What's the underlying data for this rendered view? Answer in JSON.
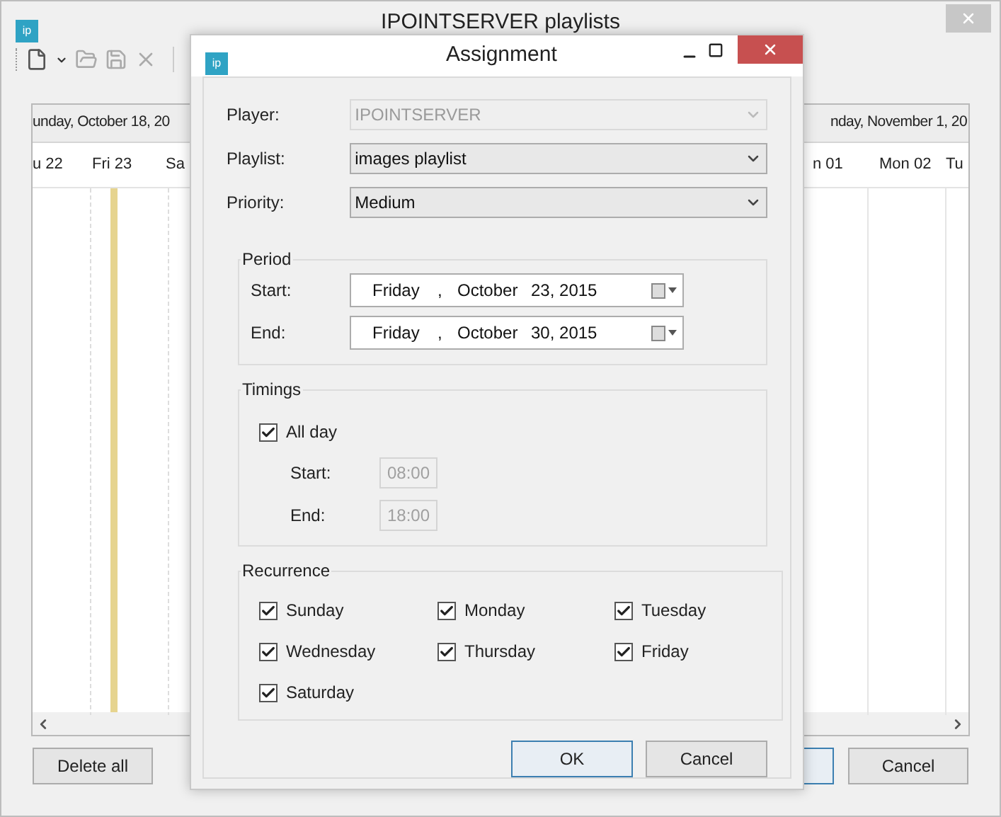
{
  "main_window": {
    "app_icon_text": "ip",
    "title": "IPOINTSERVER playlists",
    "calendar": {
      "header_left": "unday, October 18, 20",
      "header_right": "nday, November 1, 20",
      "days_left": [
        "u 22",
        "Fri 23",
        "Sa"
      ],
      "days_right": [
        "n 01",
        "Mon 02",
        "Tu"
      ]
    },
    "buttons": [
      {
        "label": "Delete all",
        "kind": "normal"
      },
      {
        "kind": "default"
      },
      {
        "label": "Cancel",
        "kind": "normal"
      }
    ]
  },
  "dialog": {
    "app_icon_text": "ip",
    "title": "Assignment",
    "fields": [
      {
        "label": "Player:",
        "value": "IPOINTSERVER",
        "disabled": true
      },
      {
        "label": "Playlist:",
        "value": "images playlist",
        "disabled": false
      },
      {
        "label": "Priority:",
        "value": "Medium",
        "disabled": false
      }
    ],
    "period": {
      "title": "Period",
      "dates": [
        {
          "label": "Start:",
          "weekday": "Friday",
          "separator": ",",
          "month": "October",
          "day_year": "23, 2015"
        },
        {
          "label": "End:",
          "weekday": "Friday",
          "separator": ",",
          "month": "October",
          "day_year": "30, 2015"
        }
      ]
    },
    "timings": {
      "title": "Timings",
      "all_day": {
        "label": "All day",
        "checked": true
      },
      "times": [
        {
          "label": "Start:",
          "value": "08:00",
          "disabled": true
        },
        {
          "label": "End:",
          "value": "18:00",
          "disabled": true
        }
      ]
    },
    "recurrence": {
      "title": "Recurrence",
      "days": [
        {
          "label": "Sunday",
          "checked": true
        },
        {
          "label": "Monday",
          "checked": true
        },
        {
          "label": "Tuesday",
          "checked": true
        },
        {
          "label": "Wednesday",
          "checked": true
        },
        {
          "label": "Thursday",
          "checked": true
        },
        {
          "label": "Friday",
          "checked": true
        },
        {
          "label": "Saturday",
          "checked": true
        }
      ]
    },
    "buttons": [
      {
        "label": "OK",
        "kind": "default"
      },
      {
        "label": "Cancel",
        "kind": "normal"
      }
    ]
  }
}
